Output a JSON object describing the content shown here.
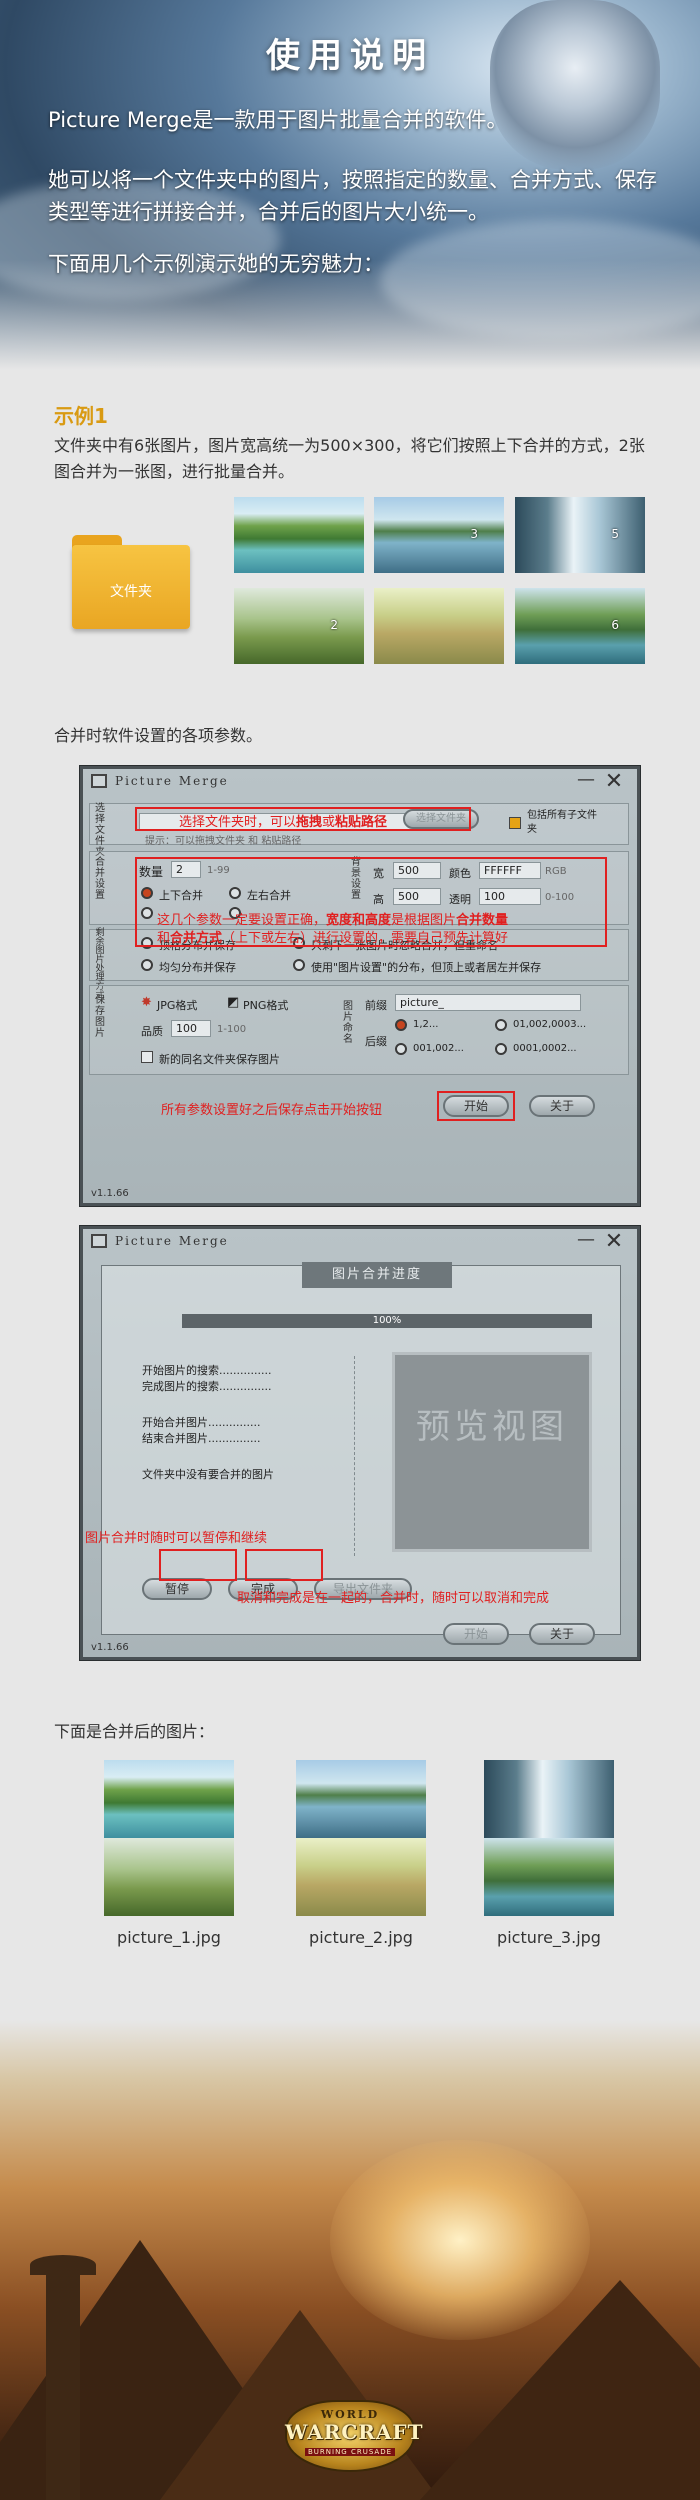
{
  "header": {
    "title": "使用说明",
    "intro": "Picture Merge是一款用于图片批量合并的软件。",
    "description": "她可以将一个文件夹中的图片，按照指定的数量、合并方式、保存类型等进行拼接合并，合并后的图片大小统一。",
    "lead": "下面用几个示例演示她的无穷魅力："
  },
  "example": {
    "title": "示例1",
    "description": "文件夹中有6张图片，图片宽高统一为500×300，将它们按照上下合并的方式，2张图合并为一张图，进行批量合并。",
    "folder_label": "文件夹",
    "thumbs": [
      "",
      "2",
      "3",
      "",
      "5",
      "6"
    ]
  },
  "settings_caption": "合并时软件设置的各项参数。",
  "window": {
    "app_title": "Picture Merge",
    "version": "v1.1.66",
    "source_label": "选择文件夹",
    "source_hint": "提示：可以拖拽文件夹 和 粘贴路径",
    "source_btn": "选择文件夹",
    "include_sub": "包括所有子文件夹",
    "merge_label": "合并设置",
    "count_label": "数量",
    "count_value": "2",
    "count_range": "1-99",
    "dir_top_bottom": "上下合并",
    "dir_left_right": "左右合并",
    "bg_label": "背景设置",
    "width_label": "宽",
    "width_value": "500",
    "height_label": "高",
    "height_value": "500",
    "color_label": "颜色",
    "color_value": "FFFFFF",
    "color_mode": "RGB",
    "alpha_label": "透明",
    "alpha_value": "100",
    "alpha_range": "0-100",
    "remain_label": "剩余图片处理方式",
    "opt_1": "顶格分布并保存",
    "opt_2": "只剩下一张图片时忽略合并，但重命名",
    "opt_3": "均匀分布并保存",
    "opt_4": "使用\"图片设置\"的分布，但顶上或者居左并保存",
    "save_label": "保存图片",
    "jpg": "JPG格式",
    "png": "PNG格式",
    "quality_label": "品质",
    "quality_value": "100",
    "quality_range": "1-100",
    "new_folder": "新的同名文件夹保存图片",
    "naming_label": "图片命名",
    "prefix_label": "前缀",
    "prefix_value": "picture_",
    "suffix_label": "后缀",
    "suffix_1": "1,2...",
    "suffix_2": "01,002,0003...",
    "suffix_3": "001,002...",
    "suffix_4": "0001,0002...",
    "start_btn": "开始",
    "close_btn": "关于"
  },
  "annotations": {
    "drag_prefix": "选择文件夹时，可以",
    "drag_bold": "拖拽",
    "drag_mid": "或",
    "paste_bold": "粘贴路径",
    "params_line1_a": "这几个参数一定要设置正确，",
    "params_line1_b": "宽度和高度",
    "params_line1_c": "是根据图片",
    "params_line1_d": "合并数量",
    "params_line2_a": "和",
    "params_line2_b": "合并方式",
    "params_line2_c": "（上下或左右）进行设置的，需要自己预先计算好",
    "start_note": "所有参数设置好之后保存点击开始按钮",
    "pause_note": "图片合并时随时可以暂停和继续",
    "cancel_note": "取消和完成是在一起的，合并时，随时可以取消和完成"
  },
  "progress": {
    "dialog_title": "图片合并进度",
    "percent": "100%",
    "progress_value": 1.0,
    "line1": "开始图片的搜索...............",
    "line2": "完成图片的搜索...............",
    "line3": "开始合并图片...............",
    "line4": "结束合并图片...............",
    "line5": "文件夹中没有要合并的图片",
    "preview": "预览视图",
    "pause_btn": "暂停",
    "finish_btn": "完成",
    "export_btn": "导出文件夹",
    "start_btn": "开始",
    "close_btn": "关于"
  },
  "results": {
    "caption": "下面是合并后的图片：",
    "files": [
      "picture_1.jpg",
      "picture_2.jpg",
      "picture_3.jpg"
    ]
  },
  "footer": {
    "logo_line1": "WORLD",
    "logo_line2": "WARCRAFT",
    "logo_line3": "BURNING CRUSADE"
  }
}
